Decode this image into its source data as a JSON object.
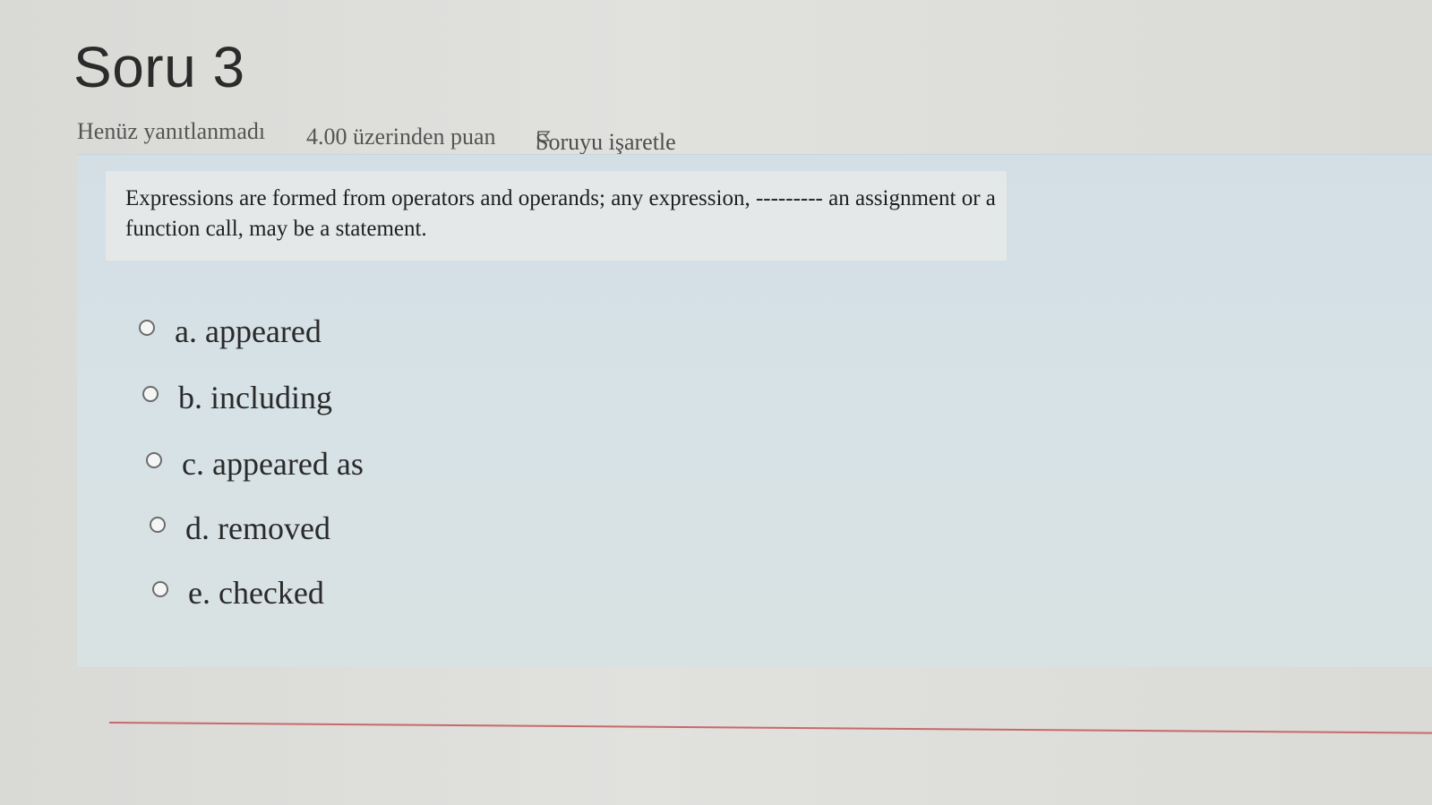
{
  "question": {
    "title": "Soru 3",
    "status": "Henüz yanıtlanmadı",
    "points": "4.00 üzerinden puan",
    "flag_label": "Soruyu işaretle",
    "flag_icon": "flag-icon",
    "text": "Expressions are formed from operators and operands; any expression, --------- an assignment or a function call, may be a statement."
  },
  "options": [
    {
      "label": "a. appeared",
      "selected": false
    },
    {
      "label": "b. including",
      "selected": false
    },
    {
      "label": "c. appeared as",
      "selected": false
    },
    {
      "label": "d. removed",
      "selected": false
    },
    {
      "label": "e. checked",
      "selected": false
    }
  ],
  "colors": {
    "background": "#dcdcdc",
    "question_box": "#d6e1e5",
    "question_text_box": "#e4e8e8",
    "divider": "#c76a6a"
  }
}
